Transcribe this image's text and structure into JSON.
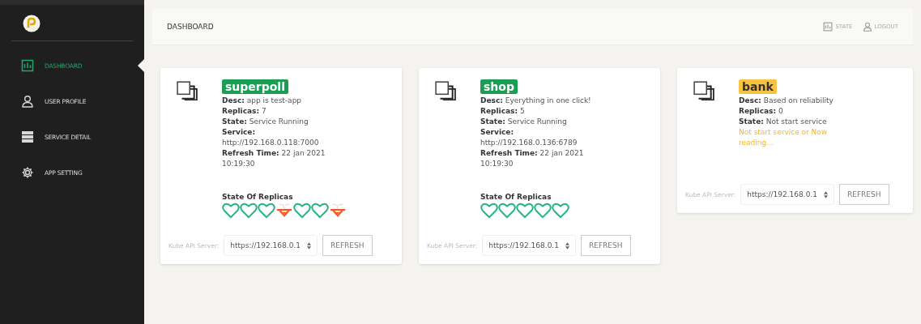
{
  "sidebar": {
    "items": [
      {
        "label": "DASHBOARD",
        "kind": "chart",
        "selected": true
      },
      {
        "label": "USER PROFILE",
        "kind": "user",
        "selected": false
      },
      {
        "label": "SERVICE DETAIL",
        "kind": "list",
        "selected": false
      },
      {
        "label": "APP SETTING",
        "kind": "gear",
        "selected": false
      }
    ]
  },
  "header": {
    "title": "DASHBOARD",
    "links": [
      {
        "label": "STATE",
        "kind": "chart"
      },
      {
        "label": "LOGOUT",
        "kind": "user"
      }
    ]
  },
  "services": [
    {
      "name": "superpoll",
      "color": "#1a9e54",
      "fields": [
        {
          "label": "Desc:",
          "value": "app is test-app"
        },
        {
          "label": "Replicas:",
          "value": "7"
        },
        {
          "label": "State:",
          "value": "Service Running"
        },
        {
          "label": "Service:",
          "value": "http://192.168.0.118:7000"
        },
        {
          "label": "Refresh Time:",
          "value": "22 jan 2021 10:19:30"
        }
      ],
      "replicas_title": "State Of Replicas",
      "replicas": [
        {
          "healthy": true
        },
        {
          "healthy": true
        },
        {
          "healthy": true
        },
        {
          "healthy": false
        },
        {
          "healthy": true
        },
        {
          "healthy": true
        },
        {
          "healthy": false
        }
      ],
      "server_label": "Kube API Server:",
      "server": "https://192.168.0.1",
      "button": "REFRESH"
    },
    {
      "name": "shop",
      "color": "#1a9e54",
      "fields": [
        {
          "label": "Desc:",
          "value": "Eyerything in one click!"
        },
        {
          "label": "Replicas:",
          "value": "5"
        },
        {
          "label": "State:",
          "value": "Service Running"
        },
        {
          "label": "Service:",
          "value": "http://192.168.0.136:6789"
        },
        {
          "label": "Refresh Time:",
          "value": "22 jan 2021 10:19:30"
        }
      ],
      "replicas_title": "State Of Replicas",
      "replicas": [
        {
          "healthy": true
        },
        {
          "healthy": true
        },
        {
          "healthy": true
        },
        {
          "healthy": true
        },
        {
          "healthy": true
        }
      ],
      "server_label": "Kube API Server:",
      "server": "https://192.168.0.1",
      "button": "REFRESH"
    },
    {
      "name": "bank",
      "color": "#f6c343",
      "fields": [
        {
          "label": "Desc:",
          "value": "Based on reliability"
        },
        {
          "label": "Replicas:",
          "value": "0"
        },
        {
          "label": "State:",
          "value": "Not start service"
        }
      ],
      "note": "Not start service or Now reading...",
      "server_label": "Kube API Server:",
      "server": "https://192.168.0.1",
      "button": "REFRESH"
    }
  ]
}
